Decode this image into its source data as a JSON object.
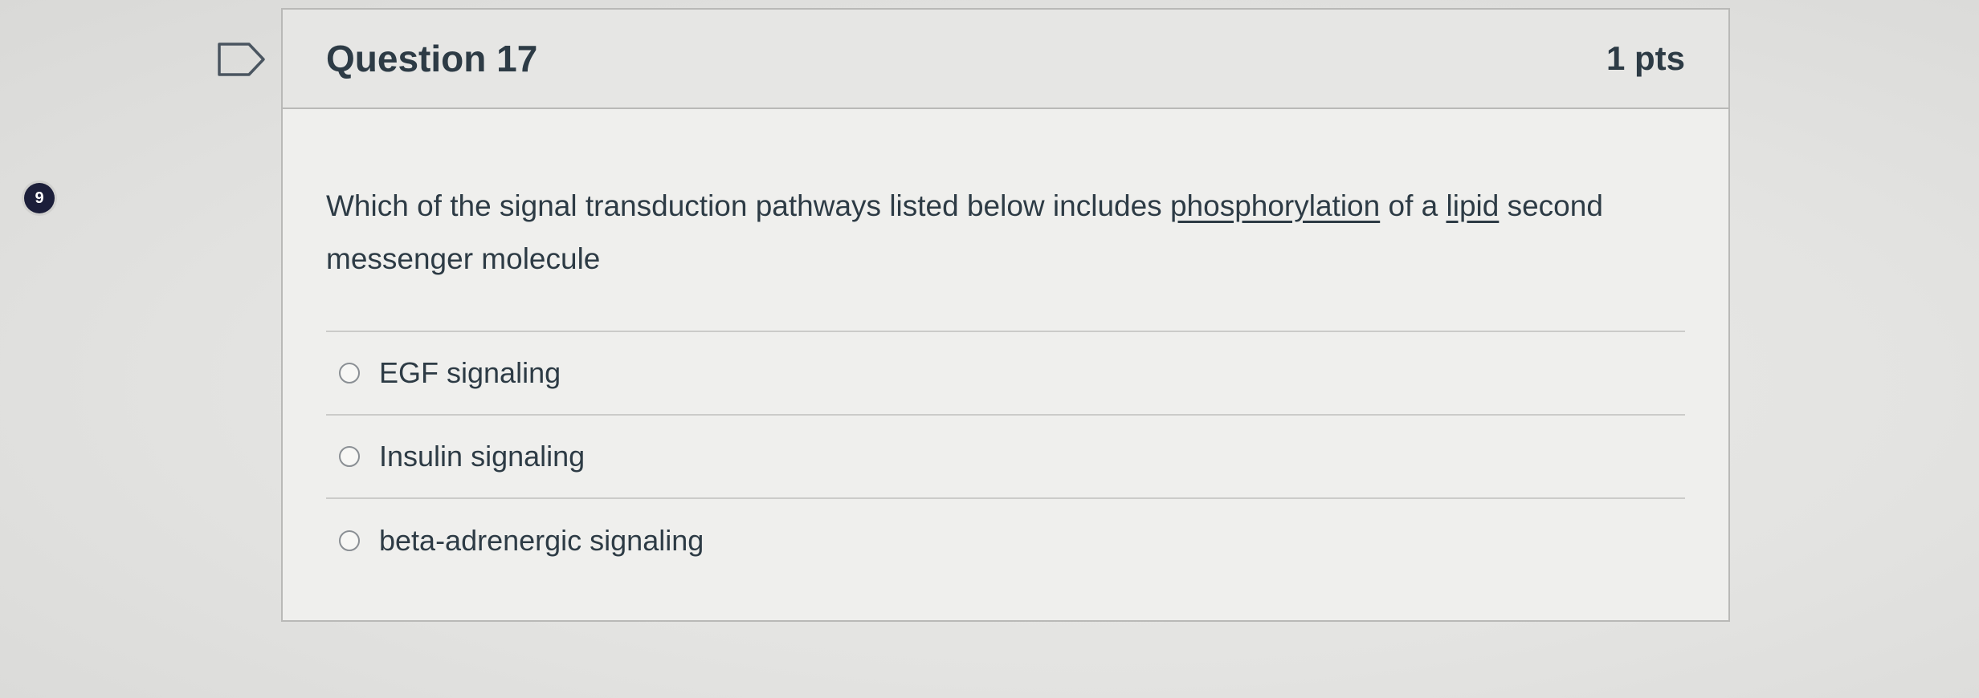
{
  "side_badge": {
    "number": "9",
    "color": "#1c1f3a"
  },
  "question": {
    "title": "Question 17",
    "points": "1 pts",
    "text_parts": [
      "Which of the signal transduction pathways listed below includes ",
      "phosphorylation",
      " of a ",
      "lipid",
      " second messenger molecule"
    ]
  },
  "answers": [
    {
      "label": "EGF signaling",
      "selected": false
    },
    {
      "label": "Insulin signaling",
      "selected": false
    },
    {
      "label": "beta-adrenergic signaling",
      "selected": false
    }
  ],
  "icons": {
    "flag": "flag-question-icon",
    "radio": "radio-button-icon"
  },
  "colors": {
    "text": "#2d3b45",
    "header_bg": "#e6e6e4",
    "card_bg": "#efefed",
    "border": "#b9b9b7"
  }
}
